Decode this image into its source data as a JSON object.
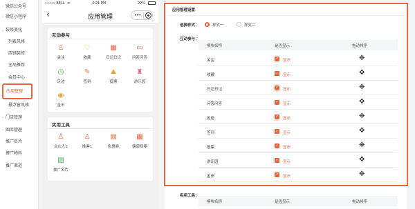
{
  "sidebar": {
    "items": [
      {
        "label": "微信公众号",
        "chev": "›"
      },
      {
        "label": "微信小程序",
        "chev": "›"
      },
      {
        "label": "装修美化",
        "chev": "⌄"
      },
      {
        "label": "列表风格",
        "chev": ""
      },
      {
        "label": "店铺装修",
        "chev": ""
      },
      {
        "label": "全局推荐",
        "chev": ""
      },
      {
        "label": "会员中心",
        "chev": ""
      },
      {
        "label": "应用管理",
        "chev": ""
      },
      {
        "label": "悬浮窗风格",
        "chev": ""
      },
      {
        "label": "门店管理",
        "chev": "›"
      },
      {
        "label": "图库管理",
        "chev": "›"
      },
      {
        "label": "推广名片",
        "chev": ""
      },
      {
        "label": "推广物料",
        "chev": ""
      },
      {
        "label": "推广渠道",
        "chev": ""
      }
    ]
  },
  "phone": {
    "carrier": "••••• BELL",
    "wifi": "≋",
    "time": "4:21 PM",
    "battery": "22%",
    "back": "‹",
    "title": "应用管理",
    "capsule_dots": "•••",
    "card1": {
      "title": "互动参与",
      "tiles": [
        {
          "label": "关注",
          "icon": "follow-icon",
          "glyph": "♙",
          "color": "#e8663d"
        },
        {
          "label": "收藏",
          "icon": "heart-icon",
          "glyph": "♡",
          "color": "#e8a23d"
        },
        {
          "label": "日记日记",
          "icon": "diary-icon",
          "glyph": "▦",
          "color": "#e8663d"
        },
        {
          "label": "问答问答",
          "icon": "chat-icon",
          "glyph": "▭",
          "color": "#e8663d"
        },
        {
          "label": "足迹",
          "icon": "clock-icon",
          "glyph": "◷",
          "color": "#4caf50"
        },
        {
          "label": "签到",
          "icon": "sign-icon",
          "glyph": "✎",
          "color": "#e8663d"
        },
        {
          "label": "投票",
          "icon": "vote-icon",
          "glyph": "⛰",
          "color": "#e8a23d"
        },
        {
          "label": "游乐园",
          "icon": "game-icon",
          "glyph": "♜",
          "color": "#e85a7a"
        },
        {
          "label": "金币",
          "icon": "coin-icon",
          "glyph": "◉",
          "color": "#e8a23d"
        }
      ]
    },
    "card2": {
      "title": "实用工具",
      "tiles": [
        {
          "label": "合伙人2",
          "icon": "partner-icon",
          "glyph": "♙",
          "color": "#e8663d"
        },
        {
          "label": "推客1",
          "icon": "referrer-icon",
          "glyph": "♙",
          "color": "#e8663d"
        },
        {
          "label": "优惠券",
          "icon": "coupon-icon",
          "glyph": "▤",
          "color": "#e8663d"
        },
        {
          "label": "健康档案",
          "icon": "health-icon",
          "glyph": "▦",
          "color": "#e8663d"
        },
        {
          "label": "推广名片",
          "icon": "card-icon",
          "glyph": "▧",
          "color": "#4caf50"
        }
      ]
    }
  },
  "panel": {
    "title": "应用管理设置",
    "style_label": "选择样式：",
    "style_options": [
      "样式一",
      "样式二"
    ],
    "interact_label": "互动参与：",
    "col_name": "模块名称",
    "col_show": "是否显示",
    "col_sort": "拖动排序",
    "show_text": "显示",
    "move_glyph": "✥",
    "check_glyph": "✓",
    "rows": [
      "关注",
      "收藏",
      "日记日记",
      "问答问答",
      "足迹",
      "签到",
      "投票",
      "游乐园",
      "金币"
    ],
    "tools_label": "实用工具："
  },
  "colors": {
    "accent": "#e8663d"
  }
}
